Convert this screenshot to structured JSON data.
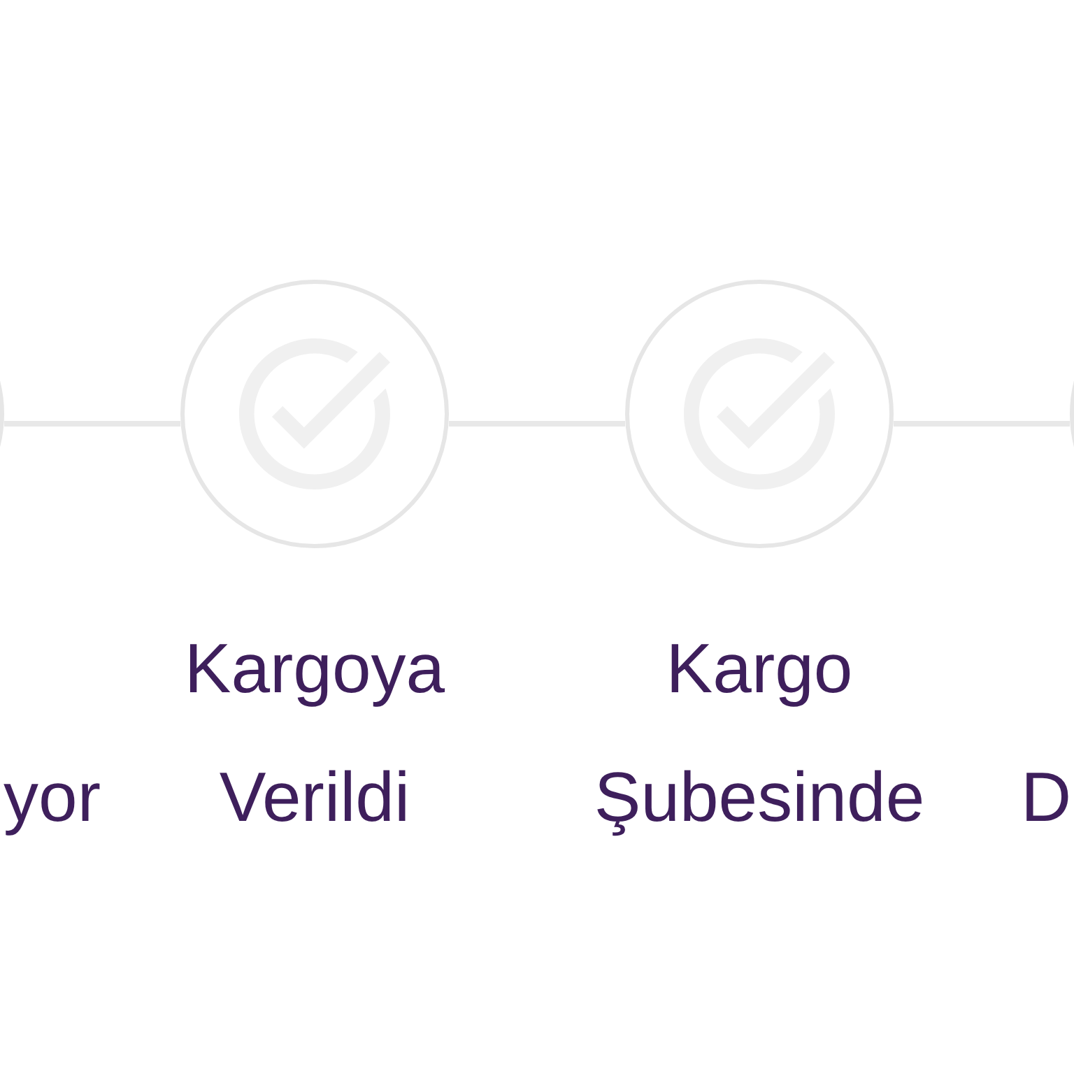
{
  "steps": [
    {
      "kind": "edge_left",
      "title_bottom": "yor",
      "completed": false
    },
    {
      "kind": "full",
      "title_top": "Kargoya",
      "title_bottom": "Verildi",
      "completed": false
    },
    {
      "kind": "full",
      "title_top": "Kargo",
      "title_bottom": "Şubesinde",
      "completed": false
    },
    {
      "kind": "edge_right",
      "title_bottom": "D",
      "completed": false
    }
  ]
}
